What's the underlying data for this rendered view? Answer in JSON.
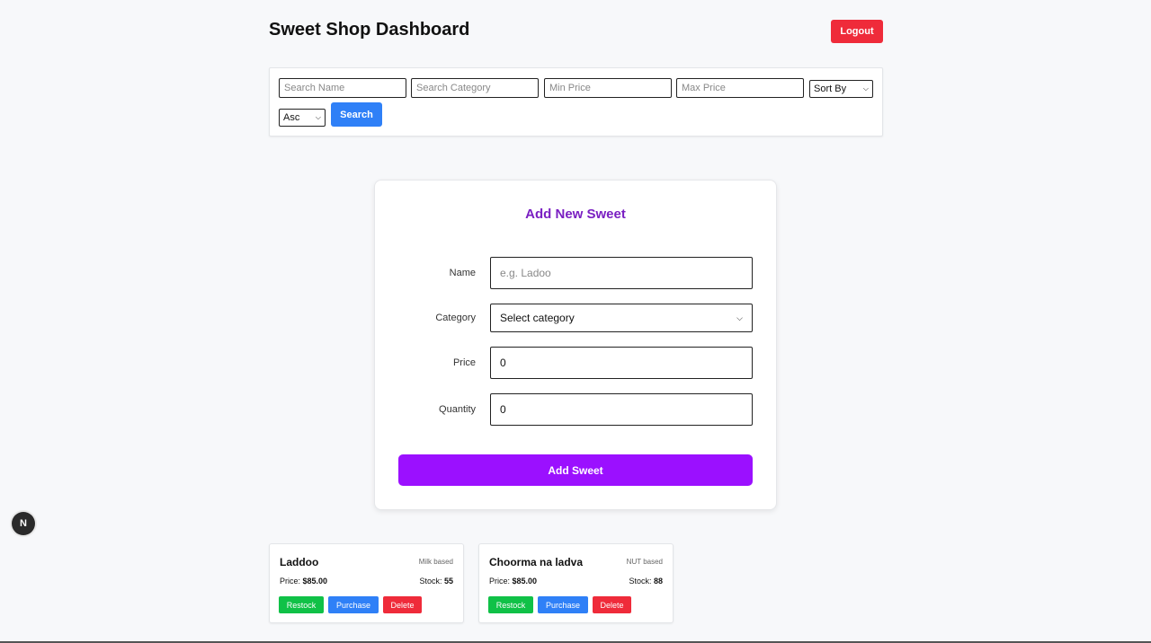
{
  "header": {
    "title": "Sweet Shop Dashboard",
    "logout_label": "Logout"
  },
  "filters": {
    "search_name_placeholder": "Search Name",
    "search_category_placeholder": "Search Category",
    "min_price_placeholder": "Min Price",
    "max_price_placeholder": "Max Price",
    "sort_by_value": "Sort By",
    "order_value": "Asc",
    "search_label": "Search"
  },
  "form": {
    "title": "Add New Sweet",
    "name_label": "Name",
    "name_placeholder": "e.g. Ladoo",
    "category_label": "Category",
    "category_value": "Select category",
    "price_label": "Price",
    "price_value": "0",
    "quantity_label": "Quantity",
    "quantity_value": "0",
    "submit_label": "Add Sweet"
  },
  "badge": {
    "letter": "N"
  },
  "sweets": [
    {
      "name": "Laddoo",
      "category": "Milk based",
      "price_label": "Price:",
      "price": "$85.00",
      "stock_label": "Stock:",
      "stock": "55",
      "restock_label": "Restock",
      "purchase_label": "Purchase",
      "delete_label": "Delete"
    },
    {
      "name": "Choorma na ladva",
      "category": "NUT based",
      "price_label": "Price:",
      "price": "$85.00",
      "stock_label": "Stock:",
      "stock": "88",
      "restock_label": "Restock",
      "purchase_label": "Purchase",
      "delete_label": "Delete"
    }
  ],
  "colors": {
    "accent_purple": "#9b10ff",
    "title_purple": "#7a1fc2",
    "danger": "#ef2b3a",
    "primary": "#2f80f7",
    "success": "#10c147"
  }
}
